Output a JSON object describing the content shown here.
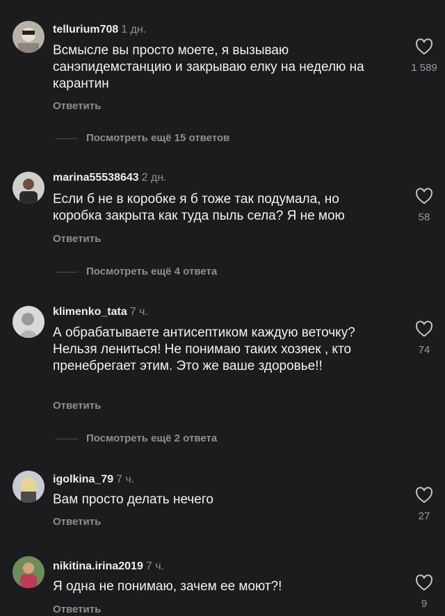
{
  "comments": [
    {
      "username": "tellurium708",
      "time": "1 дн.",
      "text": "Всмысле вы просто моете, я вызываю санэпидемстанцию и закрываю елку на неделю на карантин",
      "reply": "Ответить",
      "likes": "1 589",
      "more_replies": "Посмотреть ещё 15 ответов"
    },
    {
      "username": "marina55538643",
      "time": "2 дн.",
      "text": "Если б не в коробке я б тоже так подумала, но коробка закрыта как туда пыль села? Я не мою",
      "reply": "Ответить",
      "likes": "58",
      "more_replies": "Посмотреть ещё 4 ответа"
    },
    {
      "username": "klimenko_tata",
      "time": "7 ч.",
      "text": "А обрабатываете антисептиком каждую веточку? Нельзя лениться! Не понимаю таких хозяек , кто пренебрегает этим. Это же ваше здоровье!!",
      "reply": "Ответить",
      "likes": "74",
      "more_replies": "Посмотреть ещё 2 ответа"
    },
    {
      "username": "igolkina_79",
      "time": "7 ч.",
      "text": "Вам просто делать нечего",
      "reply": "Ответить",
      "likes": "27"
    },
    {
      "username": "nikitina.irina2019",
      "time": "7 ч.",
      "text": "Я одна не понимаю, зачем ее моют?!",
      "reply": "Ответить",
      "likes": "9"
    }
  ],
  "icons": {
    "like": "heart-outline-icon",
    "avatar": "user-avatar-photo"
  },
  "colors": {
    "background": "#1c1c1e",
    "text": "#f2f2f2",
    "muted": "#8e8e93"
  }
}
